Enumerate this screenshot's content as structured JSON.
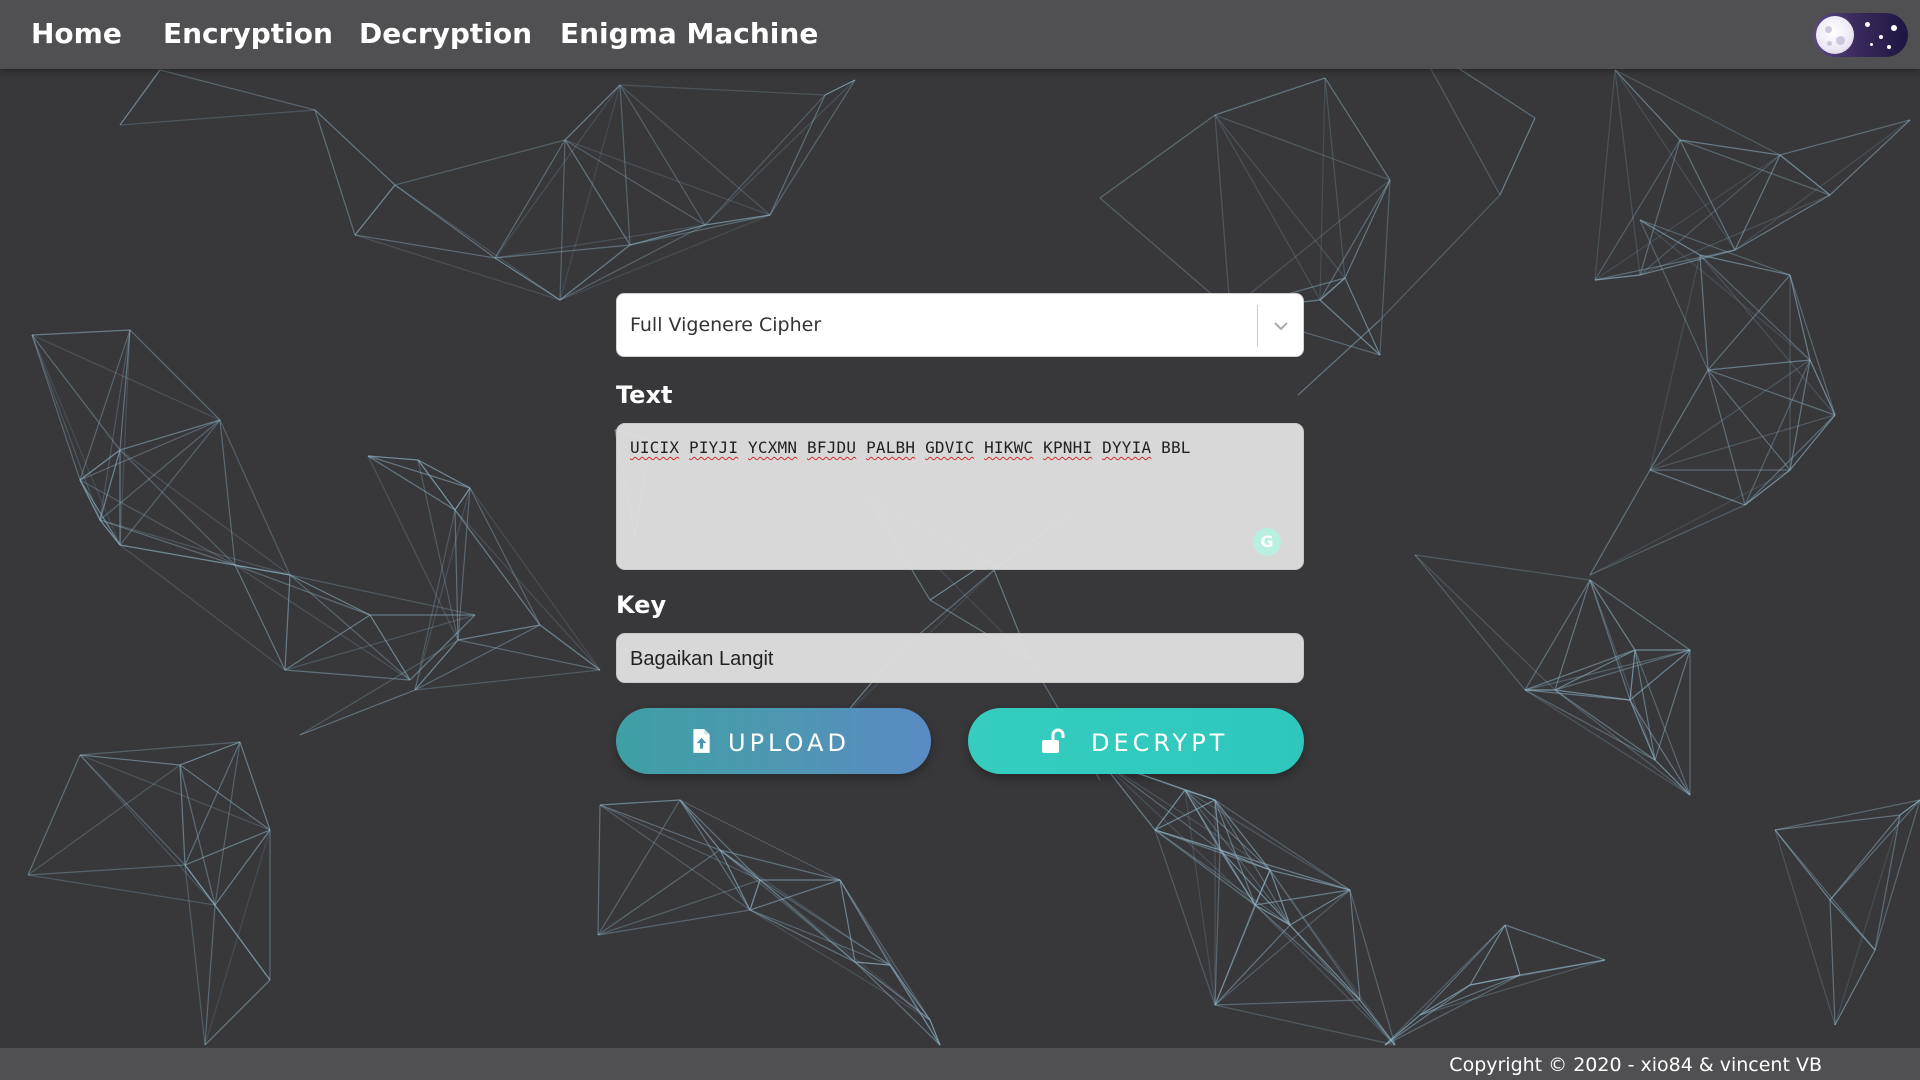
{
  "nav": {
    "items": [
      {
        "label": "Home"
      },
      {
        "label": "Encryption"
      },
      {
        "label": "Decryption"
      },
      {
        "label": "Enigma Machine"
      }
    ],
    "theme_toggle_icon": "moon-toggle-icon"
  },
  "form": {
    "cipher_select": {
      "value": "Full Vigenere Cipher",
      "icon": "chevron-down-icon"
    },
    "text_label": "Text",
    "text_words": [
      "UICIX",
      "PIYJI",
      "YCXMN",
      "BFJDU",
      "PALBH",
      "GDVIC",
      "HIKWC",
      "KPNHI",
      "DYYIA",
      "BBL"
    ],
    "grammarly_letter": "G",
    "key_label": "Key",
    "key_value": "Bagaikan Langit",
    "upload_button": {
      "label": "UPLOAD",
      "icon": "file-upload-icon"
    },
    "decrypt_button": {
      "label": "DECRYPT",
      "icon": "unlock-icon"
    }
  },
  "footer": {
    "copyright": "Copyright © 2020 - xio84 & vincent VB"
  },
  "colors": {
    "background": "#38383b",
    "navbar": "#505052",
    "network_lines": "#8fb3c4",
    "upload_start": "#3ea0a4",
    "upload_end": "#5a8bc4",
    "decrypt": "#32cabf"
  }
}
